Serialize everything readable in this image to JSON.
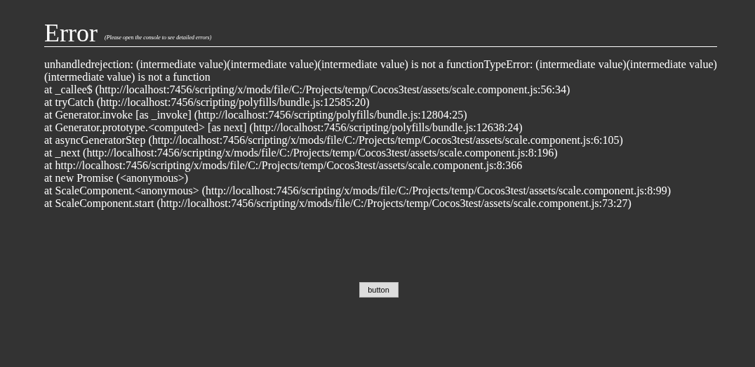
{
  "error": {
    "title": "Error",
    "hint": "(Please open the console to see detailed errors)",
    "message": "unhandledrejection: (intermediate value)(intermediate value)(intermediate value) is not a functionTypeError: (intermediate value)(intermediate value)(intermediate value) is not a function",
    "stack": [
      "at _callee$ (http://localhost:7456/scripting/x/mods/file/C:/Projects/temp/Cocos3test/assets/scale.component.js:56:34)",
      "at tryCatch (http://localhost:7456/scripting/polyfills/bundle.js:12585:20)",
      "at Generator.invoke [as _invoke] (http://localhost:7456/scripting/polyfills/bundle.js:12804:25)",
      "at Generator.prototype.<computed> [as next] (http://localhost:7456/scripting/polyfills/bundle.js:12638:24)",
      "at asyncGeneratorStep (http://localhost:7456/scripting/x/mods/file/C:/Projects/temp/Cocos3test/assets/scale.component.js:6:105)",
      "at _next (http://localhost:7456/scripting/x/mods/file/C:/Projects/temp/Cocos3test/assets/scale.component.js:8:196)",
      "at http://localhost:7456/scripting/x/mods/file/C:/Projects/temp/Cocos3test/assets/scale.component.js:8:366",
      "at new Promise (<anonymous>)",
      "at ScaleComponent.<anonymous> (http://localhost:7456/scripting/x/mods/file/C:/Projects/temp/Cocos3test/assets/scale.component.js:8:99)",
      "at ScaleComponent.start (http://localhost:7456/scripting/x/mods/file/C:/Projects/temp/Cocos3test/assets/scale.component.js:73:27)"
    ]
  },
  "button": {
    "label": "button"
  }
}
